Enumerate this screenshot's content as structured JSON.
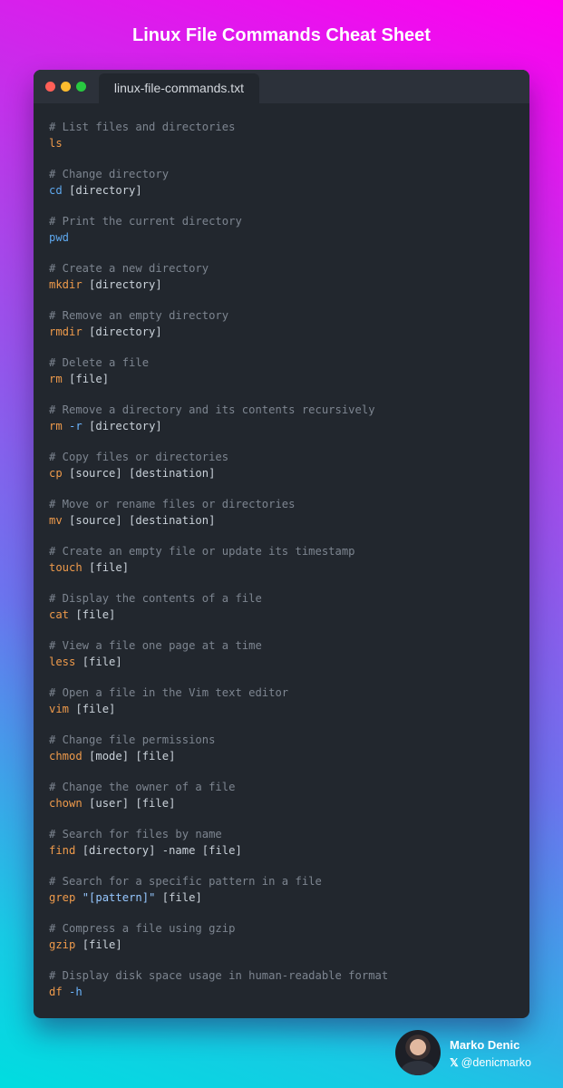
{
  "page": {
    "title": "Linux File Commands Cheat Sheet"
  },
  "window": {
    "tab_label": "linux-file-commands.txt"
  },
  "entries": [
    {
      "comment": "# List files and directories",
      "command": "ls",
      "args": ""
    },
    {
      "comment": "# Change directory",
      "command": "cd",
      "args": " [directory]"
    },
    {
      "comment": "# Print the current directory",
      "command": "pwd",
      "args": ""
    },
    {
      "comment": "# Create a new directory",
      "command": "mkdir",
      "args": " [directory]"
    },
    {
      "comment": "# Remove an empty directory",
      "command": "rmdir",
      "args": " [directory]"
    },
    {
      "comment": "# Delete a file",
      "command": "rm",
      "args": " [file]"
    },
    {
      "comment": "# Remove a directory and its contents recursively",
      "command": "rm",
      "flag": "-r",
      "args": " [directory]"
    },
    {
      "comment": "# Copy files or directories",
      "command": "cp",
      "args": " [source] [destination]"
    },
    {
      "comment": "# Move or rename files or directories",
      "command": "mv",
      "args": " [source] [destination]"
    },
    {
      "comment": "# Create an empty file or update its timestamp",
      "command": "touch",
      "args": " [file]"
    },
    {
      "comment": "# Display the contents of a file",
      "command": "cat",
      "args": " [file]"
    },
    {
      "comment": "# View a file one page at a time",
      "command": "less",
      "args": " [file]"
    },
    {
      "comment": "# Open a file in the Vim text editor",
      "command": "vim",
      "args": " [file]"
    },
    {
      "comment": "# Change file permissions",
      "command": "chmod",
      "args": " [mode] [file]"
    },
    {
      "comment": "# Change the owner of a file",
      "command": "chown",
      "args": " [user] [file]"
    },
    {
      "comment": "# Search for files by name",
      "command": "find",
      "args": " [directory] -name [file]"
    },
    {
      "comment": "# Search for a specific pattern in a file",
      "command": "grep",
      "string": "\"[pattern]\"",
      "args": " [file]"
    },
    {
      "comment": "# Compress a file using gzip",
      "command": "gzip",
      "args": " [file]"
    },
    {
      "comment": "# Display disk space usage in human-readable format",
      "command": "df",
      "flag": "-h",
      "args": ""
    }
  ],
  "author": {
    "name": "Marko Denic",
    "handle": "@denicmarko",
    "icon": "x-logo-icon"
  },
  "colors": {
    "comment": "#7d8590",
    "command": "#ee9a4b",
    "command_alt": "#5ea8ee",
    "flag": "#6cb6ff",
    "arg": "#c9d1d9"
  }
}
